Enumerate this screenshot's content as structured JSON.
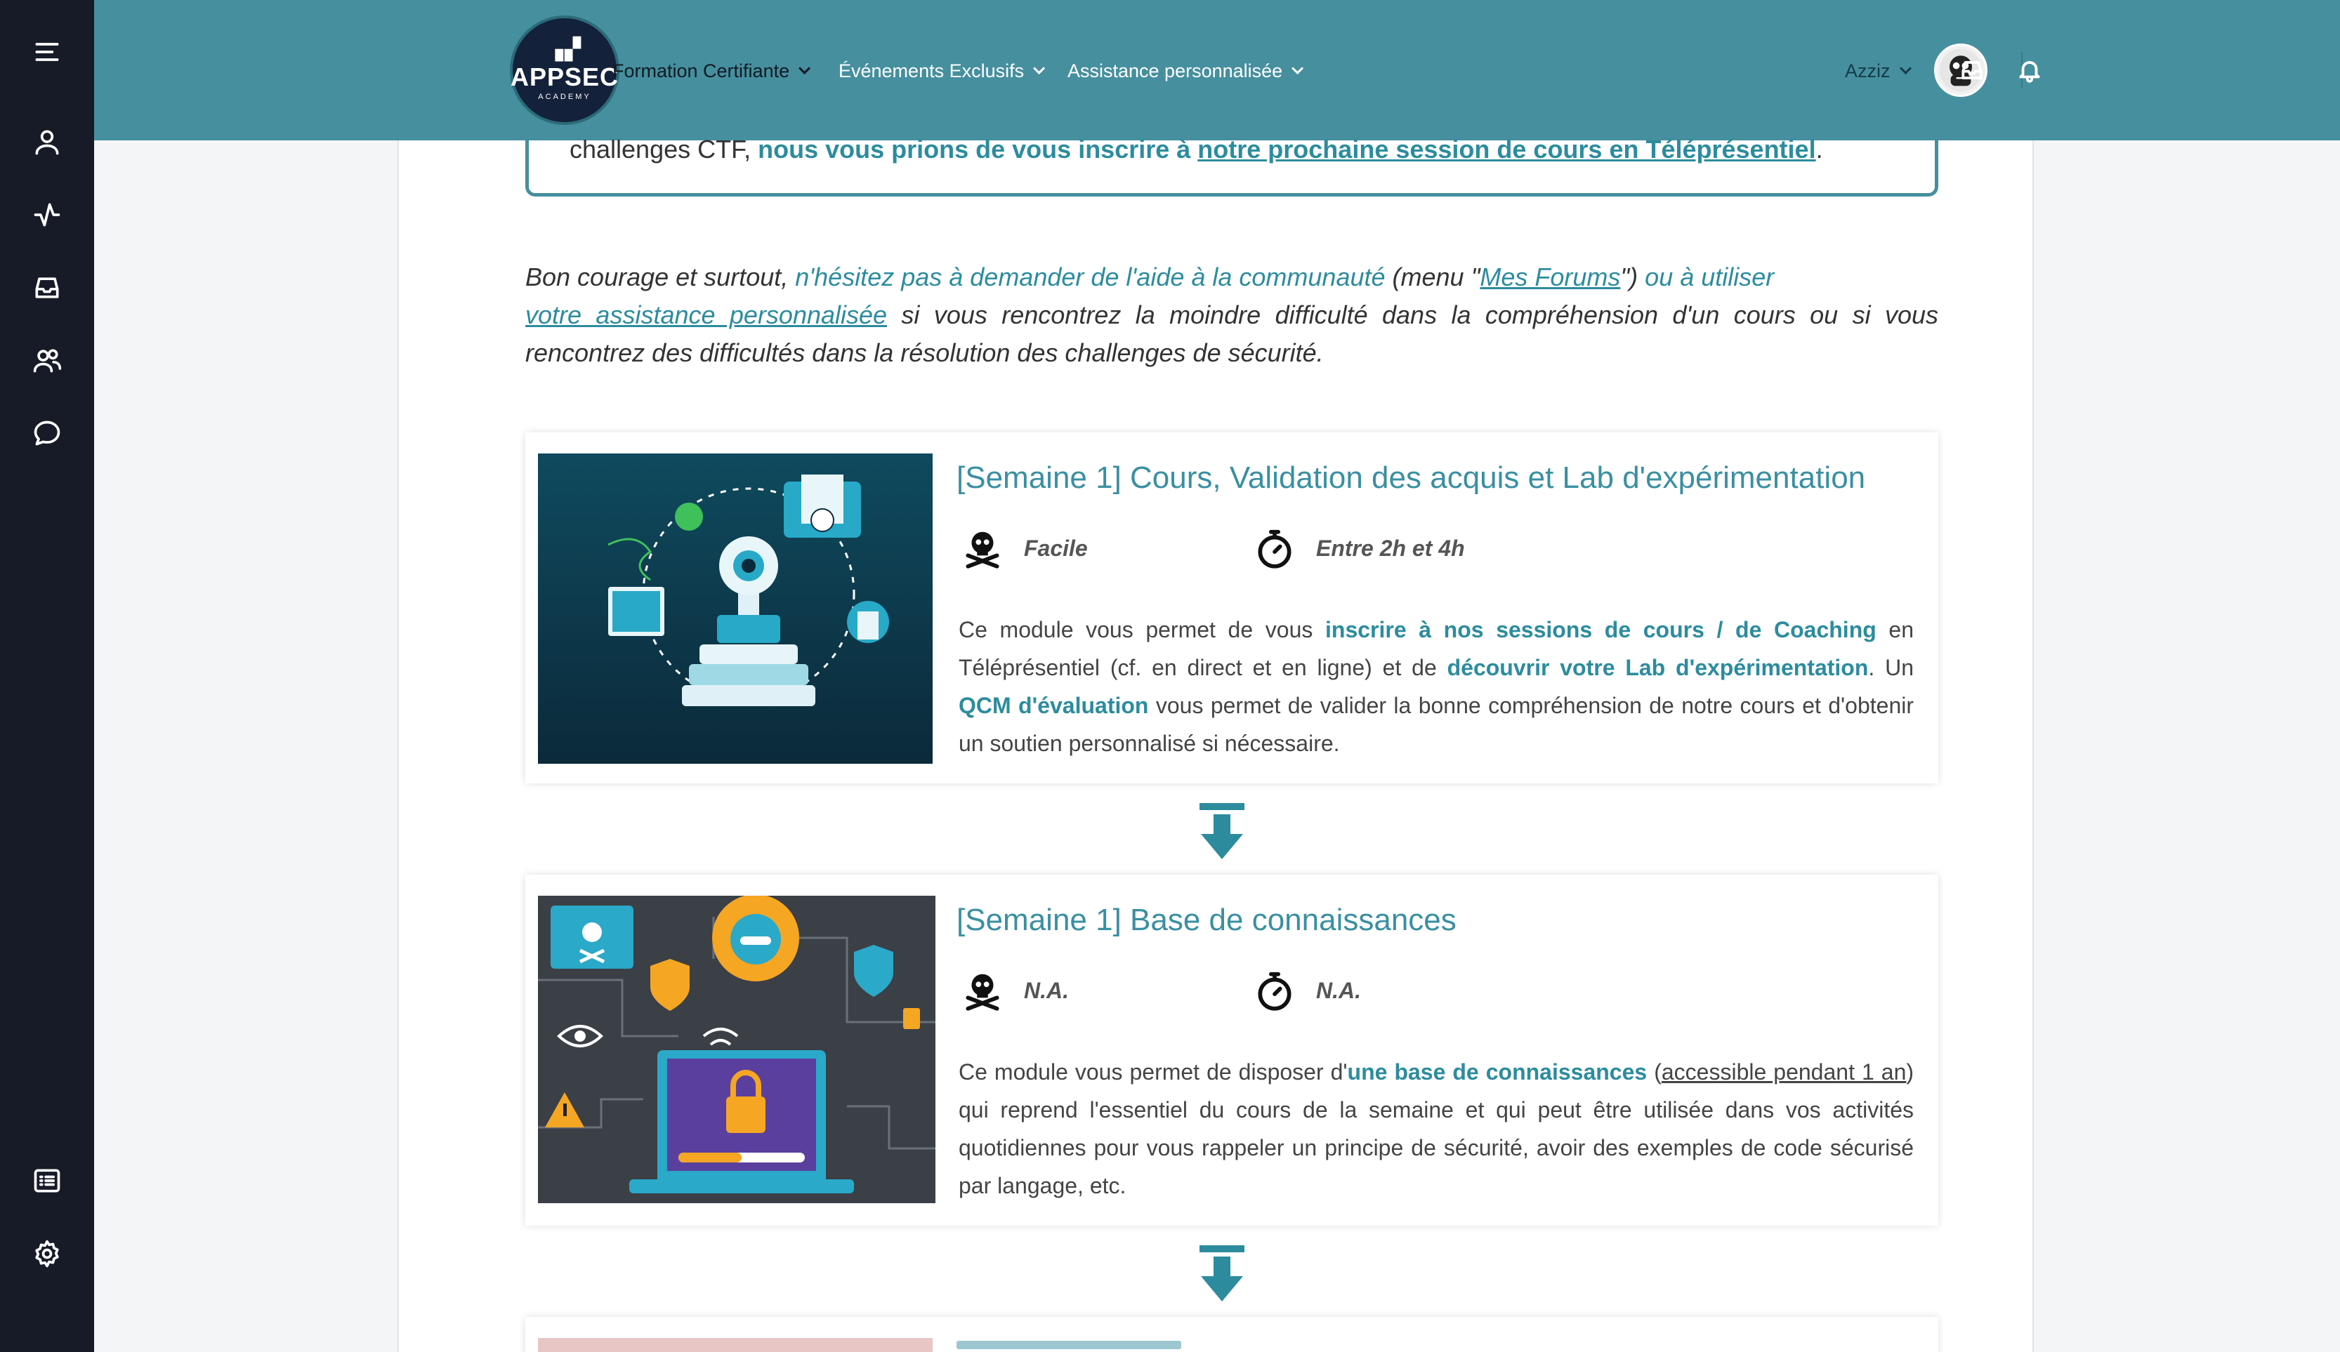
{
  "header": {
    "logo_mark": "▗▞",
    "logo_main": "APPSEC",
    "logo_sub": "ACADEMY",
    "nav": [
      {
        "label": "Formation Certifiante"
      },
      {
        "label": "Événements Exclusifs"
      },
      {
        "label": "Assistance personnalisée"
      }
    ],
    "user": "Azziz"
  },
  "notice": {
    "prefix": "challenges CTF, ",
    "bold": "nous vous prions de vous inscrire à ",
    "link": "notre prochaine session de cours en Téléprésentiel",
    "suffix": "."
  },
  "paragraph": {
    "p1": "Bon courage et surtout, ",
    "p2": "n'hésitez pas à demander de l'aide à la communauté",
    "p3": " (menu \"",
    "p4": "Mes Forums",
    "p5": "\") ",
    "p6": "ou à utiliser",
    "p7": "votre assistance personnalisée",
    "p8": " si vous rencontrez la moindre difficulté dans la compréhension d'un cours ou si vous rencontrez des difficultés dans la résolution des challenges de sécurité."
  },
  "modules": [
    {
      "title": "[Semaine 1] Cours, Validation des acquis et Lab d'expérimentation",
      "difficulty": "Facile",
      "duration": "Entre 2h et 4h",
      "d1": "Ce module vous permet de vous ",
      "d2": "inscrire à nos sessions de cours / de Coaching",
      "d3": " en Téléprésentiel (cf. en direct et en ligne) et de ",
      "d4": "découvrir votre Lab d'expérimentation",
      "d5": ". Un ",
      "d6": "QCM d'évaluation",
      "d7": " vous permet de valider la bonne compréhension de notre cours et d'obtenir un soutien personnalisé si nécessaire."
    },
    {
      "title": "[Semaine 1] Base de connaissances",
      "difficulty": "N.A.",
      "duration": "N.A.",
      "d1": "Ce module vous permet de disposer d'",
      "d2": "une base de connaissances",
      "d3": " (",
      "d4": "accessible pendant 1 an",
      "d5": ") qui reprend l'essentiel du cours de la semaine et qui peut être utilisée dans vos activités quotidiennes pour vous rappeler un principe de sécurité, avoir des exemples de code sécurisé par langage, etc."
    }
  ],
  "colors": {
    "header_bg": "#468f9e",
    "sidebar_bg": "#171a27",
    "accent": "#2c8c9e"
  },
  "icons": [
    "menu-icon",
    "user-icon",
    "activity-icon",
    "inbox-icon",
    "users-icon",
    "chat-icon",
    "list-icon",
    "gear-icon",
    "bell-icon",
    "skull-icon",
    "stopwatch-icon",
    "arrow-down-icon"
  ]
}
